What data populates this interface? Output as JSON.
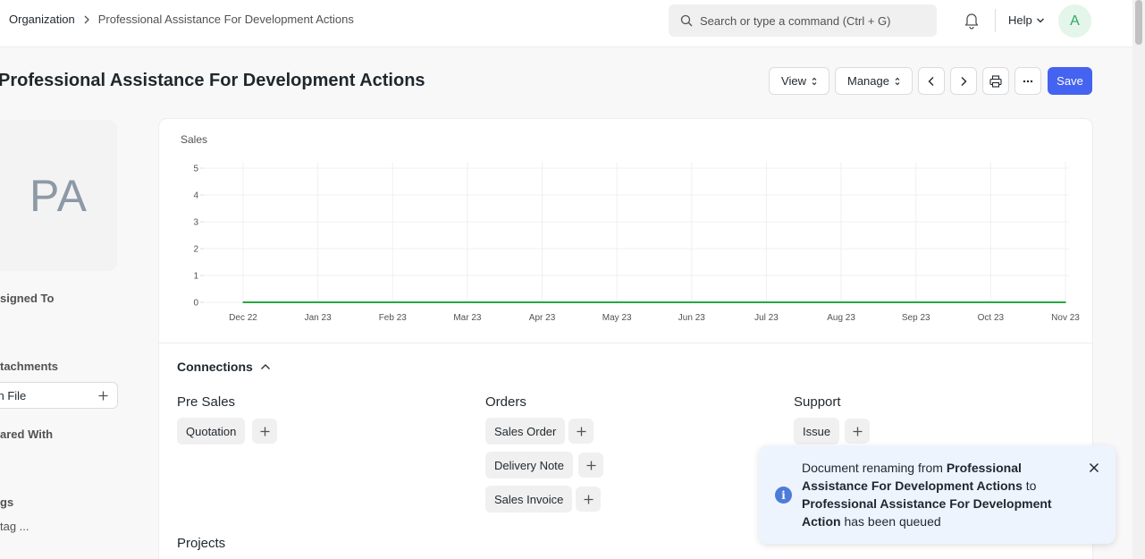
{
  "navbar": {
    "breadcrumb_root": "Organization",
    "breadcrumb_current": "Professional Assistance For Development Actions",
    "search_placeholder": "Search or type a command (Ctrl + G)",
    "help_label": "Help",
    "avatar_initial": "A"
  },
  "page": {
    "title": "Professional Assistance For Development Actions",
    "buttons": {
      "view": "View",
      "manage": "Manage",
      "save": "Save"
    }
  },
  "sidebar": {
    "image_initials": "PA",
    "assigned_to": "signed To",
    "attachments": "tachments",
    "attach_file": "ch File",
    "shared_with": "ared With",
    "tags": "gs",
    "add_tag": "tag ..."
  },
  "chart_data": {
    "type": "line",
    "title": "Sales",
    "categories": [
      "Dec 22",
      "Jan 23",
      "Feb 23",
      "Mar 23",
      "Apr 23",
      "May 23",
      "Jun 23",
      "Jul 23",
      "Aug 23",
      "Sep 23",
      "Oct 23",
      "Nov 23"
    ],
    "series": [
      {
        "values": [
          0,
          0,
          0,
          0,
          0,
          0,
          0,
          0,
          0,
          0,
          0,
          0
        ],
        "color": "#28a745"
      }
    ],
    "yticks": [
      "0",
      "1",
      "2",
      "3",
      "4",
      "5"
    ],
    "ylim": [
      0,
      5
    ],
    "grid": true
  },
  "connections": {
    "title": "Connections",
    "groups": {
      "pre_sales": {
        "title": "Pre Sales",
        "items": [
          "Quotation"
        ]
      },
      "orders": {
        "title": "Orders",
        "items": [
          "Sales Order",
          "Delivery Note",
          "Sales Invoice"
        ]
      },
      "support": {
        "title": "Support",
        "items": [
          "Issue"
        ]
      }
    },
    "projects_title": "Projects"
  },
  "toast": {
    "prefix": "Document renaming from ",
    "old_name": "Professional Assistance For Development Actions",
    "middle": " to ",
    "new_name": "Professional Assistance For Development Action",
    "suffix": " has been queued"
  }
}
